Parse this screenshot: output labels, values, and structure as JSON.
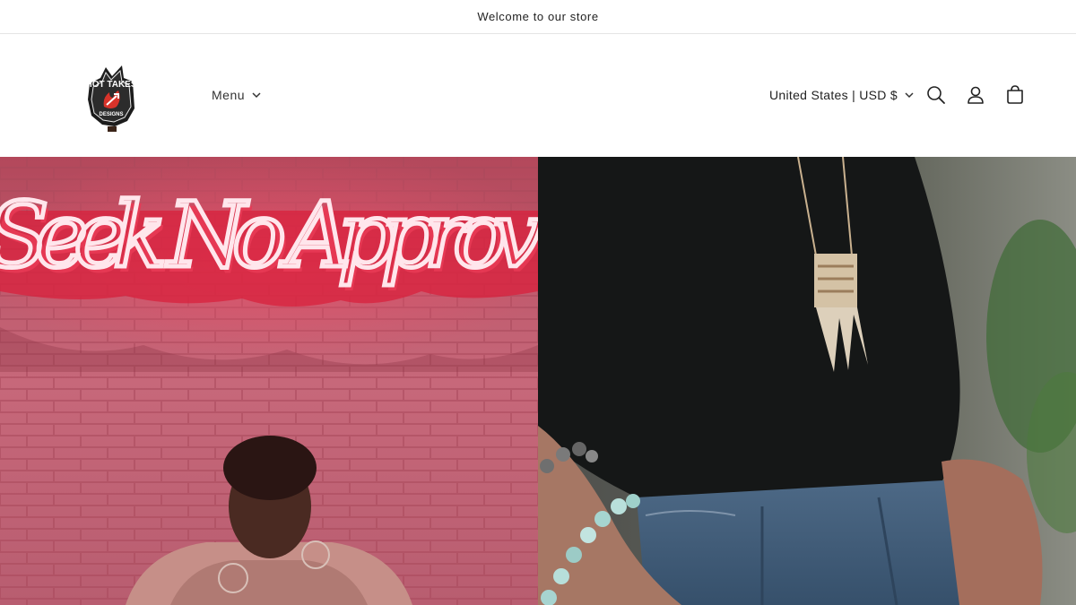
{
  "announcement": {
    "text": "Welcome to our store"
  },
  "header": {
    "logo": {
      "icon": "hot-takes-designs-logo",
      "text_top": "HOT TAKES",
      "text_bottom": "DESIGNS"
    },
    "menu_label": "Menu",
    "country_label": "United States | USD $",
    "icons": [
      "search-icon",
      "account-icon",
      "cart-icon"
    ]
  },
  "hero": {
    "left_image": {
      "sign_text": "Seek No Approv"
    },
    "right_image": {}
  }
}
